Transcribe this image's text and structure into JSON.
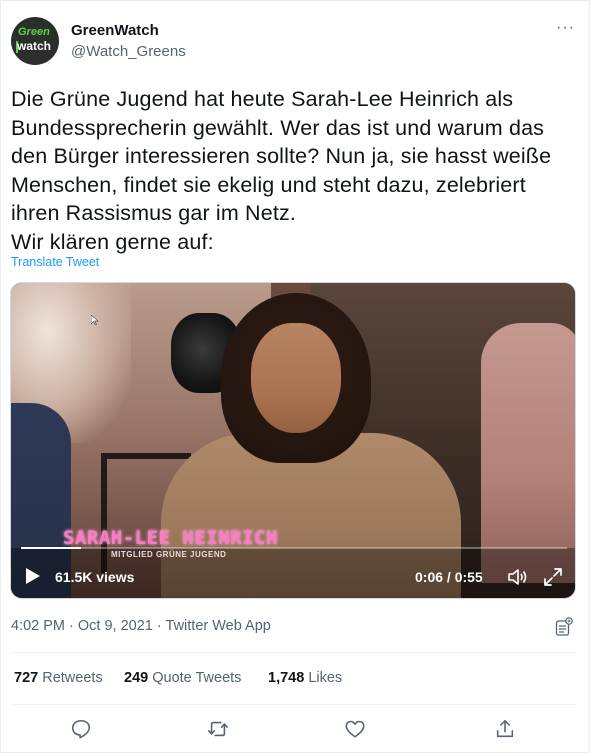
{
  "tweet": {
    "author": {
      "display_name": "GreenWatch",
      "handle": "@Watch_Greens",
      "avatar_line1": "Green",
      "avatar_line2": "watch"
    },
    "text": "Die Grüne Jugend hat heute Sarah-Lee Heinrich als\nBundessprecherin gewählt. Wer das ist und warum das\nden Bürger interessieren sollte? Nun ja, sie hasst weiße\nMenschen, findet sie ekelig und steht dazu, zelebriert\nihren Rassismus gar im Netz.\nWir klären gerne auf:",
    "translate_label": "Translate Tweet",
    "more_icon": "more-dots-icon",
    "video": {
      "overlay_name": "SARAH-LEE HEINRICH",
      "overlay_subtitle": "MITGLIED GRÜNE JUGEND",
      "views": "61.5K views",
      "time": "0:06 / 0:55",
      "progress_fraction": 0.109,
      "icons": [
        "play-icon",
        "volume-icon",
        "fullscreen-icon"
      ]
    },
    "meta": {
      "time": "4:02 PM",
      "sep1": "·",
      "date": "Oct 9, 2021",
      "sep2": "·",
      "source": "Twitter Web App"
    },
    "stats": {
      "retweets_count": "727",
      "retweets_label": "Retweets",
      "quotes_count": "249",
      "quotes_label": "Quote Tweets",
      "likes_count": "1,748",
      "likes_label": "Likes"
    },
    "actions": [
      "reply-icon",
      "retweet-icon",
      "like-icon",
      "share-icon"
    ]
  },
  "colors": {
    "text_primary": "#0f1419",
    "text_secondary": "#536471",
    "link": "#1d9bf0",
    "overlay_pink": "#ff78c8",
    "divider": "#eff3f4"
  }
}
